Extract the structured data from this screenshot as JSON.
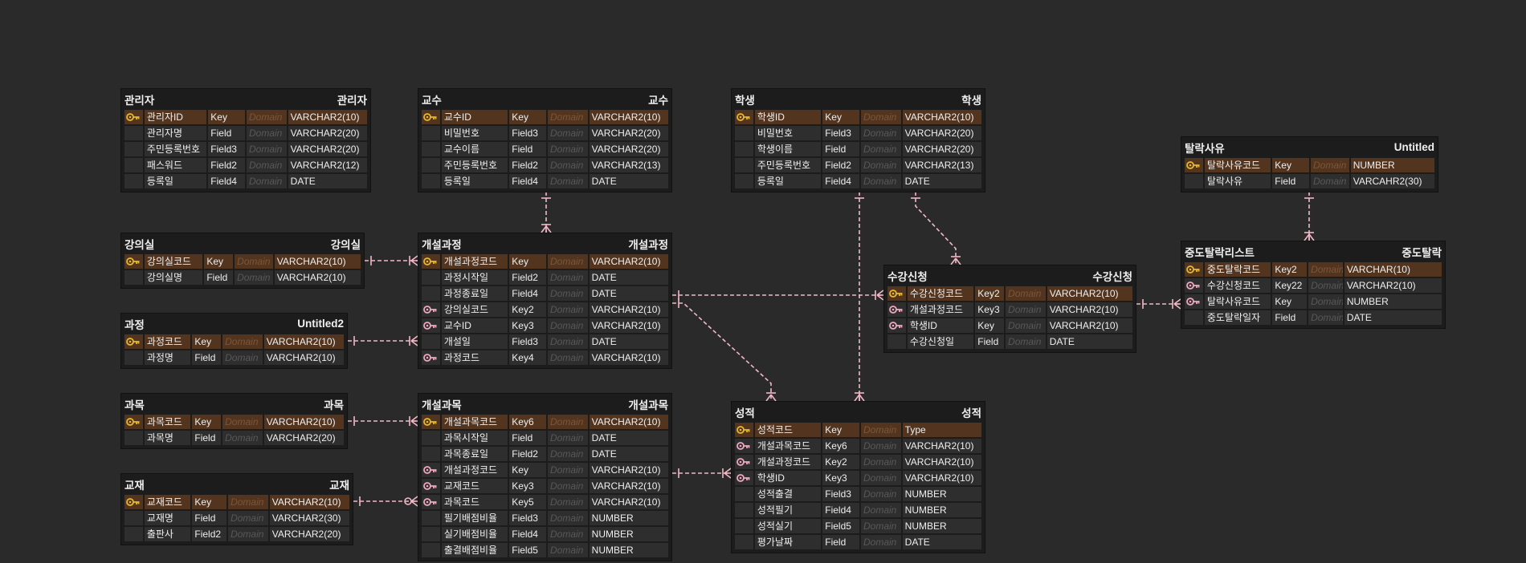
{
  "entities": [
    {
      "id": "admin",
      "title": "관리자",
      "alias": "관리자",
      "cols": [
        25,
        80,
        48,
        52,
        101
      ],
      "rows": [
        {
          "icon": "key-gold",
          "name": "관리자ID",
          "key": "Key",
          "domain": "Domain",
          "type": "VARCHAR2(10)",
          "pk": true
        },
        {
          "icon": "",
          "name": "관리자명",
          "key": "Field",
          "domain": "Domain",
          "type": "VARCHAR2(20)"
        },
        {
          "icon": "",
          "name": "주민등록번호",
          "key": "Field3",
          "domain": "Domain",
          "type": "VARCHAR2(20)"
        },
        {
          "icon": "",
          "name": "패스워드",
          "key": "Field2",
          "domain": "Domain",
          "type": "VARCHAR2(12)"
        },
        {
          "icon": "",
          "name": "등록일",
          "key": "Field4",
          "domain": "Domain",
          "type": "DATE"
        }
      ]
    },
    {
      "id": "professor",
      "title": "교수",
      "alias": "교수",
      "cols": [
        25,
        85,
        48,
        52,
        101
      ],
      "rows": [
        {
          "icon": "key-gold",
          "name": "교수ID",
          "key": "Key",
          "domain": "Domain",
          "type": "VARCHAR2(10)",
          "pk": true
        },
        {
          "icon": "",
          "name": "비밀번호",
          "key": "Field3",
          "domain": "Domain",
          "type": "VARCHAR2(20)"
        },
        {
          "icon": "",
          "name": "교수이름",
          "key": "Field",
          "domain": "Domain",
          "type": "VARCHAR2(20)"
        },
        {
          "icon": "",
          "name": "주민등록번호",
          "key": "Field2",
          "domain": "Domain",
          "type": "VARCHAR2(13)"
        },
        {
          "icon": "",
          "name": "등록일",
          "key": "Field4",
          "domain": "Domain",
          "type": "DATE"
        }
      ]
    },
    {
      "id": "student",
      "title": "학생",
      "alias": "학생",
      "cols": [
        25,
        85,
        48,
        52,
        101
      ],
      "rows": [
        {
          "icon": "key-gold",
          "name": "학생ID",
          "key": "Key",
          "domain": "Domain",
          "type": "VARCHAR2(10)",
          "pk": true
        },
        {
          "icon": "",
          "name": "비밀번호",
          "key": "Field3",
          "domain": "Domain",
          "type": "VARCHAR2(20)"
        },
        {
          "icon": "",
          "name": "학생이름",
          "key": "Field",
          "domain": "Domain",
          "type": "VARCHAR2(20)"
        },
        {
          "icon": "",
          "name": "주민등록번호",
          "key": "Field2",
          "domain": "Domain",
          "type": "VARCHAR2(13)"
        },
        {
          "icon": "",
          "name": "등록일",
          "key": "Field4",
          "domain": "Domain",
          "type": "DATE"
        }
      ]
    },
    {
      "id": "dropreason",
      "title": "탈락사유",
      "alias": "Untitled",
      "cols": [
        25,
        85,
        48,
        50,
        107
      ],
      "rows": [
        {
          "icon": "key-gold",
          "name": "탈락사유코드",
          "key": "Key",
          "domain": "Domain",
          "type": "NUMBER",
          "pk": true
        },
        {
          "icon": "",
          "name": "탈락사유",
          "key": "Field",
          "domain": "Domain",
          "type": "VARCAHR2(30)"
        }
      ]
    },
    {
      "id": "room",
      "title": "강의실",
      "alias": "강의실",
      "cols": [
        25,
        75,
        38,
        50,
        110
      ],
      "rows": [
        {
          "icon": "key-gold",
          "name": "강의실코드",
          "key": "Key",
          "domain": "Domain",
          "type": "VARCHAR2(10)",
          "pk": true
        },
        {
          "icon": "",
          "name": "강의실명",
          "key": "Field",
          "domain": "Domain",
          "type": "VARCHAR2(10)"
        }
      ]
    },
    {
      "id": "opencourse",
      "title": "개설과정",
      "alias": "개설과정",
      "cols": [
        25,
        85,
        48,
        52,
        101
      ],
      "rows": [
        {
          "icon": "key-gold",
          "name": "개설과정코드",
          "key": "Key",
          "domain": "Domain",
          "type": "VARCHAR2(10)",
          "pk": true
        },
        {
          "icon": "",
          "name": "과정시작일",
          "key": "Field2",
          "domain": "Domain",
          "type": "DATE"
        },
        {
          "icon": "",
          "name": "과정종료일",
          "key": "Field4",
          "domain": "Domain",
          "type": "DATE"
        },
        {
          "icon": "key-pink",
          "name": "강의실코드",
          "key": "Key2",
          "domain": "Domain",
          "type": "VARCHAR2(10)"
        },
        {
          "icon": "key-pink",
          "name": "교수ID",
          "key": "Key3",
          "domain": "Domain",
          "type": "VARCHAR2(10)"
        },
        {
          "icon": "",
          "name": "개설일",
          "key": "Field3",
          "domain": "Domain",
          "type": "DATE"
        },
        {
          "icon": "key-pink",
          "name": "과정코드",
          "key": "Key4",
          "domain": "Domain",
          "type": "VARCHAR2(10)"
        }
      ]
    },
    {
      "id": "enroll",
      "title": "수강신청",
      "alias": "수강신청",
      "cols": [
        25,
        85,
        38,
        52,
        109
      ],
      "rows": [
        {
          "icon": "key-gold",
          "name": "수강신청코드",
          "key": "Key2",
          "domain": "Domain",
          "type": "VARCHAR2(10)",
          "pk": true
        },
        {
          "icon": "key-pink",
          "name": "개설과정코드",
          "key": "Key3",
          "domain": "Domain",
          "type": "VARCHAR2(10)"
        },
        {
          "icon": "key-pink",
          "name": "학생ID",
          "key": "Key",
          "domain": "Domain",
          "type": "VARCHAR2(10)"
        },
        {
          "icon": "",
          "name": "수강신청일",
          "key": "Field",
          "domain": "Domain",
          "type": "DATE"
        }
      ]
    },
    {
      "id": "dropout",
      "title": "중도탈락리스트",
      "alias": "중도탈락",
      "cols": [
        25,
        85,
        45,
        45,
        124
      ],
      "rows": [
        {
          "icon": "key-gold",
          "name": "중도탈락코드",
          "key": "Key2",
          "domain": "Domain",
          "type": "VARCHAR(10)",
          "pk": true
        },
        {
          "icon": "key-pink",
          "name": "수강신청코드",
          "key": "Key22",
          "domain": "Domain",
          "type": "VARCHAR2(10)"
        },
        {
          "icon": "key-pink",
          "name": "탈락사유코드",
          "key": "Key",
          "domain": "Domain",
          "type": "NUMBER"
        },
        {
          "icon": "",
          "name": "중도탈락일자",
          "key": "Field",
          "domain": "Domain",
          "type": "DATE"
        }
      ]
    },
    {
      "id": "course",
      "title": "과정",
      "alias": "Untitled2",
      "cols": [
        25,
        60,
        38,
        52,
        102
      ],
      "rows": [
        {
          "icon": "key-gold",
          "name": "과정코드",
          "key": "Key",
          "domain": "Domain",
          "type": "VARCHAR2(10)",
          "pk": true
        },
        {
          "icon": "",
          "name": "과정명",
          "key": "Field",
          "domain": "Domain",
          "type": "VARCHAR2(10)"
        }
      ]
    },
    {
      "id": "subject",
      "title": "과목",
      "alias": "과목",
      "cols": [
        25,
        60,
        38,
        52,
        102
      ],
      "rows": [
        {
          "icon": "key-gold",
          "name": "과목코드",
          "key": "Key",
          "domain": "Domain",
          "type": "VARCHAR2(10)",
          "pk": true
        },
        {
          "icon": "",
          "name": "과목명",
          "key": "Field",
          "domain": "Domain",
          "type": "VARCHAR2(20)"
        }
      ]
    },
    {
      "id": "opensubject",
      "title": "개설과목",
      "alias": "개설과목",
      "cols": [
        25,
        85,
        48,
        52,
        101
      ],
      "rows": [
        {
          "icon": "key-gold",
          "name": "개설과목코드",
          "key": "Key6",
          "domain": "Domain",
          "type": "VARCHAR2(10)",
          "pk": true
        },
        {
          "icon": "",
          "name": "과목시작일",
          "key": "Field",
          "domain": "Domain",
          "type": "DATE"
        },
        {
          "icon": "",
          "name": "과목종료일",
          "key": "Field2",
          "domain": "Domain",
          "type": "DATE"
        },
        {
          "icon": "key-pink",
          "name": "개설과정코드",
          "key": "Key",
          "domain": "Domain",
          "type": "VARCHAR2(10)"
        },
        {
          "icon": "key-pink",
          "name": "교재코드",
          "key": "Key3",
          "domain": "Domain",
          "type": "VARCHAR2(10)"
        },
        {
          "icon": "key-pink",
          "name": "과목코드",
          "key": "Key5",
          "domain": "Domain",
          "type": "VARCHAR2(10)"
        },
        {
          "icon": "",
          "name": "필기배점비율",
          "key": "Field3",
          "domain": "Domain",
          "type": "NUMBER"
        },
        {
          "icon": "",
          "name": "실기배점비율",
          "key": "Field4",
          "domain": "Domain",
          "type": "NUMBER"
        },
        {
          "icon": "",
          "name": "출결배점비율",
          "key": "Field5",
          "domain": "Domain",
          "type": "NUMBER"
        }
      ]
    },
    {
      "id": "grade",
      "title": "성적",
      "alias": "성적",
      "cols": [
        25,
        85,
        48,
        52,
        101
      ],
      "rows": [
        {
          "icon": "key-gold",
          "name": "성적코드",
          "key": "Key",
          "domain": "Domain",
          "type": "Type",
          "pk": true
        },
        {
          "icon": "key-pink",
          "name": "개설과목코드",
          "key": "Key6",
          "domain": "Domain",
          "type": "VARCHAR2(10)"
        },
        {
          "icon": "key-pink",
          "name": "개설과정코드",
          "key": "Key2",
          "domain": "Domain",
          "type": "VARCHAR2(10)"
        },
        {
          "icon": "key-pink",
          "name": "학생ID",
          "key": "Key3",
          "domain": "Domain",
          "type": "VARCHAR2(10)"
        },
        {
          "icon": "",
          "name": "성적출결",
          "key": "Field3",
          "domain": "Domain",
          "type": "NUMBER"
        },
        {
          "icon": "",
          "name": "성적필기",
          "key": "Field4",
          "domain": "Domain",
          "type": "NUMBER"
        },
        {
          "icon": "",
          "name": "성적실기",
          "key": "Field5",
          "domain": "Domain",
          "type": "NUMBER"
        },
        {
          "icon": "",
          "name": "평가날짜",
          "key": "Field",
          "domain": "Domain",
          "type": "DATE"
        }
      ]
    },
    {
      "id": "textbook",
      "title": "교재",
      "alias": "교재",
      "cols": [
        25,
        60,
        45,
        52,
        102
      ],
      "rows": [
        {
          "icon": "key-gold",
          "name": "교재코드",
          "key": "Key",
          "domain": "Domain",
          "type": "VARCHAR2(10)",
          "pk": true
        },
        {
          "icon": "",
          "name": "교재명",
          "key": "Field",
          "domain": "Domain",
          "type": "VARCHAR2(30)"
        },
        {
          "icon": "",
          "name": "출판사",
          "key": "Field2",
          "domain": "Domain",
          "type": "VARCHAR2(20)"
        }
      ]
    }
  ],
  "relationships": [
    {
      "from": "professor",
      "to": "opencourse",
      "notation": "one-to-many"
    },
    {
      "from": "room",
      "to": "opencourse",
      "notation": "one-to-many"
    },
    {
      "from": "course",
      "to": "opencourse",
      "notation": "one-to-many"
    },
    {
      "from": "opencourse",
      "to": "enroll",
      "notation": "one-to-many"
    },
    {
      "from": "opencourse",
      "to": "grade",
      "notation": "one-to-many"
    },
    {
      "from": "student",
      "to": "enroll",
      "notation": "one-to-many"
    },
    {
      "from": "student",
      "to": "grade",
      "notation": "one-to-many"
    },
    {
      "from": "enroll",
      "to": "dropout",
      "notation": "one-to-many"
    },
    {
      "from": "dropreason",
      "to": "dropout",
      "notation": "one-to-many"
    },
    {
      "from": "subject",
      "to": "opensubject",
      "notation": "one-to-many"
    },
    {
      "from": "opensubject",
      "to": "grade",
      "notation": "one-to-many"
    },
    {
      "from": "textbook",
      "to": "opensubject",
      "notation": "one-to-zero-or-many"
    }
  ],
  "colors": {
    "background": "#2a2a2a",
    "entity_bg": "#1c1c1c",
    "pk_row": "#53351f",
    "cell": "#2e2e2e",
    "link": "#f2b8c6",
    "key_gold": "#e8b92c",
    "key_pink": "#f0a8c0"
  }
}
